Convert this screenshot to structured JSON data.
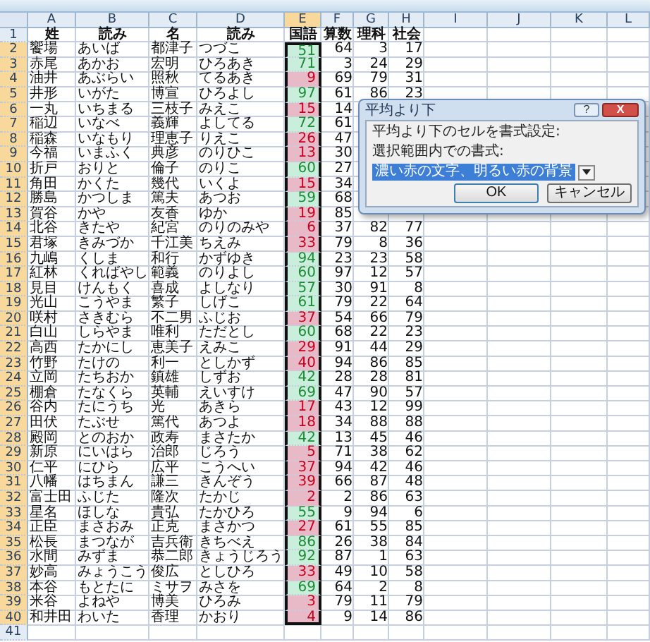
{
  "columns": [
    {
      "label": "A",
      "selected": false
    },
    {
      "label": "B",
      "selected": false
    },
    {
      "label": "C",
      "selected": false
    },
    {
      "label": "D",
      "selected": false
    },
    {
      "label": "E",
      "selected": true
    },
    {
      "label": "F",
      "selected": false
    },
    {
      "label": "G",
      "selected": false
    },
    {
      "label": "H",
      "selected": false
    },
    {
      "label": "I",
      "selected": false
    },
    {
      "label": "J",
      "selected": false
    },
    {
      "label": "K",
      "selected": false
    },
    {
      "label": "L",
      "selected": false
    }
  ],
  "rows": [
    {
      "number": "1",
      "kind": "header",
      "selected": false,
      "cells": [
        "姓",
        "読み",
        "名",
        "読み",
        "国語",
        "算数",
        "理科",
        "社会"
      ]
    },
    {
      "number": "2",
      "kind": "data",
      "selected": true,
      "below_average": false,
      "cells": [
        "饗場",
        "あいば",
        "都津子",
        "つづこ",
        "51",
        "64",
        "3",
        "17"
      ]
    },
    {
      "number": "3",
      "kind": "data",
      "selected": true,
      "below_average": false,
      "cells": [
        "赤尾",
        "あかお",
        "宏明",
        "ひろあき",
        "71",
        "3",
        "24",
        "29"
      ]
    },
    {
      "number": "4",
      "kind": "data",
      "selected": true,
      "below_average": true,
      "cells": [
        "油井",
        "あぶらい",
        "照秋",
        "てるあき",
        "9",
        "69",
        "79",
        "31"
      ]
    },
    {
      "number": "5",
      "kind": "data",
      "selected": true,
      "below_average": false,
      "cells": [
        "井形",
        "いがた",
        "博宣",
        "ひろよし",
        "97",
        "61",
        "86",
        "23"
      ]
    },
    {
      "number": "6",
      "kind": "data",
      "selected": true,
      "below_average": true,
      "cells": [
        "一丸",
        "いちまる",
        "三枝子",
        "みえこ",
        "15",
        "14"
      ]
    },
    {
      "number": "7",
      "kind": "data",
      "selected": true,
      "below_average": false,
      "cells": [
        "稲辺",
        "いなべ",
        "義輝",
        "よしてる",
        "72",
        "61"
      ]
    },
    {
      "number": "8",
      "kind": "data",
      "selected": true,
      "below_average": true,
      "cells": [
        "稲森",
        "いなもり",
        "理恵子",
        "りえこ",
        "26",
        "47"
      ]
    },
    {
      "number": "9",
      "kind": "data",
      "selected": true,
      "below_average": true,
      "cells": [
        "今福",
        "いまふく",
        "典彦",
        "のりひこ",
        "13",
        "30"
      ]
    },
    {
      "number": "10",
      "kind": "data",
      "selected": true,
      "below_average": false,
      "cells": [
        "折戸",
        "おりと",
        "倫子",
        "のりこ",
        "60",
        "27"
      ]
    },
    {
      "number": "11",
      "kind": "data",
      "selected": true,
      "below_average": true,
      "cells": [
        "角田",
        "かくた",
        "幾代",
        "いくよ",
        "15",
        "34"
      ]
    },
    {
      "number": "12",
      "kind": "data",
      "selected": true,
      "below_average": false,
      "cells": [
        "勝島",
        "かつしま",
        "篤夫",
        "あつお",
        "59",
        "68"
      ]
    },
    {
      "number": "13",
      "kind": "data",
      "selected": true,
      "below_average": true,
      "cells": [
        "賀谷",
        "かや",
        "友香",
        "ゆか",
        "19",
        "85"
      ]
    },
    {
      "number": "14",
      "kind": "data",
      "selected": true,
      "below_average": true,
      "cells": [
        "北谷",
        "きたや",
        "紀宮",
        "のりのみや",
        "6",
        "37",
        "82",
        "77"
      ]
    },
    {
      "number": "15",
      "kind": "data",
      "selected": true,
      "below_average": true,
      "cells": [
        "君塚",
        "きみづか",
        "千江美",
        "ちえみ",
        "33",
        "79",
        "8",
        "36"
      ]
    },
    {
      "number": "16",
      "kind": "data",
      "selected": true,
      "below_average": false,
      "cells": [
        "九嶋",
        "くしま",
        "和行",
        "かずゆき",
        "94",
        "23",
        "23",
        "58"
      ]
    },
    {
      "number": "17",
      "kind": "data",
      "selected": true,
      "below_average": false,
      "cells": [
        "紅林",
        "くればやし",
        "範義",
        "のりよし",
        "60",
        "97",
        "12",
        "57"
      ]
    },
    {
      "number": "18",
      "kind": "data",
      "selected": true,
      "below_average": false,
      "cells": [
        "見目",
        "けんもく",
        "喜成",
        "よしなり",
        "57",
        "30",
        "91",
        "8"
      ]
    },
    {
      "number": "19",
      "kind": "data",
      "selected": true,
      "below_average": false,
      "cells": [
        "光山",
        "こうやま",
        "繁子",
        "しげこ",
        "61",
        "79",
        "22",
        "64"
      ]
    },
    {
      "number": "20",
      "kind": "data",
      "selected": true,
      "below_average": true,
      "cells": [
        "咲村",
        "さきむら",
        "不二男",
        "ふじお",
        "37",
        "54",
        "66",
        "79"
      ]
    },
    {
      "number": "21",
      "kind": "data",
      "selected": true,
      "below_average": false,
      "cells": [
        "白山",
        "しらやま",
        "唯利",
        "ただとし",
        "60",
        "68",
        "22",
        "23"
      ]
    },
    {
      "number": "22",
      "kind": "data",
      "selected": true,
      "below_average": true,
      "cells": [
        "高西",
        "たかにし",
        "恵美子",
        "えみこ",
        "29",
        "91",
        "44",
        "29"
      ]
    },
    {
      "number": "23",
      "kind": "data",
      "selected": true,
      "below_average": true,
      "cells": [
        "竹野",
        "たけの",
        "利一",
        "としかず",
        "40",
        "94",
        "86",
        "85"
      ]
    },
    {
      "number": "24",
      "kind": "data",
      "selected": true,
      "below_average": false,
      "cells": [
        "立岡",
        "たちおか",
        "鎮雄",
        "しずお",
        "42",
        "28",
        "28",
        "81"
      ]
    },
    {
      "number": "25",
      "kind": "data",
      "selected": true,
      "below_average": false,
      "cells": [
        "棚倉",
        "たなくら",
        "英輔",
        "えいすけ",
        "69",
        "47",
        "90",
        "57"
      ]
    },
    {
      "number": "26",
      "kind": "data",
      "selected": true,
      "below_average": true,
      "cells": [
        "谷内",
        "たにうち",
        "光",
        "あきら",
        "17",
        "43",
        "12",
        "99"
      ]
    },
    {
      "number": "27",
      "kind": "data",
      "selected": true,
      "below_average": true,
      "cells": [
        "田伏",
        "たぶせ",
        "篤代",
        "あつよ",
        "18",
        "34",
        "88",
        "88"
      ]
    },
    {
      "number": "28",
      "kind": "data",
      "selected": true,
      "below_average": false,
      "cells": [
        "殿岡",
        "とのおか",
        "政寿",
        "まさたか",
        "42",
        "13",
        "45",
        "46"
      ]
    },
    {
      "number": "29",
      "kind": "data",
      "selected": true,
      "below_average": true,
      "cells": [
        "新原",
        "にいはら",
        "治郎",
        "じろう",
        "5",
        "71",
        "38",
        "62"
      ]
    },
    {
      "number": "30",
      "kind": "data",
      "selected": true,
      "below_average": true,
      "cells": [
        "仁平",
        "にひら",
        "広平",
        "こうへい",
        "37",
        "94",
        "42",
        "46"
      ]
    },
    {
      "number": "31",
      "kind": "data",
      "selected": true,
      "below_average": true,
      "cells": [
        "八幡",
        "はちまん",
        "謙三",
        "きんぞう",
        "39",
        "66",
        "87",
        "48"
      ]
    },
    {
      "number": "32",
      "kind": "data",
      "selected": true,
      "below_average": true,
      "cells": [
        "富士田",
        "ふじた",
        "隆次",
        "たかじ",
        "2",
        "2",
        "86",
        "63"
      ]
    },
    {
      "number": "33",
      "kind": "data",
      "selected": true,
      "below_average": false,
      "cells": [
        "星名",
        "ほしな",
        "貴弘",
        "たかひろ",
        "55",
        "9",
        "94",
        "6"
      ]
    },
    {
      "number": "34",
      "kind": "data",
      "selected": true,
      "below_average": true,
      "cells": [
        "正臣",
        "まさおみ",
        "正克",
        "まさかつ",
        "27",
        "61",
        "55",
        "85"
      ]
    },
    {
      "number": "35",
      "kind": "data",
      "selected": true,
      "below_average": false,
      "cells": [
        "松長",
        "まつなが",
        "吉兵衛",
        "きちべえ",
        "86",
        "26",
        "38",
        "84"
      ]
    },
    {
      "number": "36",
      "kind": "data",
      "selected": true,
      "below_average": false,
      "cells": [
        "水間",
        "みずま",
        "恭二郎",
        "きょうじろう",
        "92",
        "87",
        "1",
        "63"
      ]
    },
    {
      "number": "37",
      "kind": "data",
      "selected": true,
      "below_average": true,
      "cells": [
        "妙高",
        "みょうこう",
        "俊広",
        "としひろ",
        "33",
        "49",
        "10",
        "58"
      ]
    },
    {
      "number": "38",
      "kind": "data",
      "selected": true,
      "below_average": false,
      "cells": [
        "本谷",
        "もとたに",
        "ミサヲ",
        "みさを",
        "69",
        "64",
        "2",
        "8"
      ]
    },
    {
      "number": "39",
      "kind": "data",
      "selected": true,
      "below_average": true,
      "cells": [
        "米谷",
        "よねや",
        "博美",
        "ひろみ",
        "3",
        "79",
        "11",
        "79"
      ]
    },
    {
      "number": "40",
      "kind": "data",
      "selected": true,
      "below_average": true,
      "cells": [
        "和井田",
        "わいた",
        "香理",
        "かおり",
        "4",
        "9",
        "14",
        "86"
      ]
    },
    {
      "number": "41",
      "kind": "empty",
      "selected": false
    }
  ],
  "dialog": {
    "title": "平均より下",
    "help": "?",
    "close": "X",
    "prompt": "平均より下のセルを書式設定:",
    "format_label": "選択範囲内での書式:",
    "format_value": "濃い赤の文字、明るい赤の背景",
    "buttons": [
      "OK",
      "キャンセル"
    ]
  }
}
